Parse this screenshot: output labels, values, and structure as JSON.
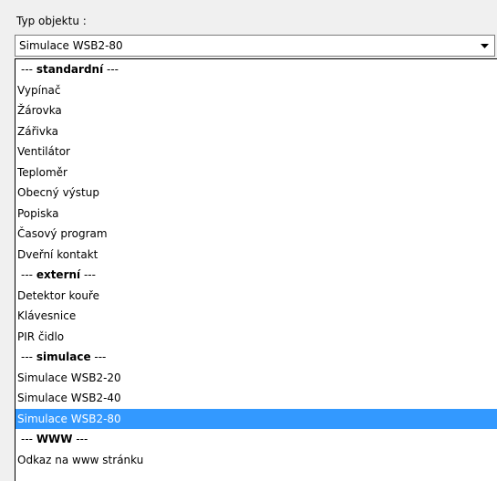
{
  "label": "Typ objektu :",
  "combo": {
    "value": "Simulace WSB2-80",
    "arrow_icon": "dropdown-arrow-icon"
  },
  "colors": {
    "selection": "#3399ff",
    "selection_text": "#ffffff",
    "background": "#f0f0f0"
  },
  "groups": {
    "standardni": {
      "dashes": "--- ",
      "name": "standardní",
      "tail": " ---"
    },
    "externi": {
      "dashes": "--- ",
      "name": "externí",
      "tail": " ---"
    },
    "simulace": {
      "dashes": "--- ",
      "name": "simulace",
      "tail": " ---"
    },
    "www": {
      "dashes": "--- ",
      "name": "WWW",
      "tail": " ---"
    }
  },
  "items": {
    "vypinac": "Vypínač",
    "zarovka": "Žárovka",
    "zarivka": "Zářivka",
    "ventilator": "Ventilátor",
    "teplomer": "Teploměr",
    "obecny_vystup": "Obecný výstup",
    "popiska": "Popiska",
    "casovy_program": "Časový program",
    "dverni_kontakt": "Dveřní kontakt",
    "detektor_koure": "Detektor kouře",
    "klavesnice": "Klávesnice",
    "pir_cidlo": "PIR čidlo",
    "wsb2_20": "Simulace WSB2-20",
    "wsb2_40": "Simulace WSB2-40",
    "wsb2_80": "Simulace WSB2-80",
    "odkaz": "Odkaz na www stránku"
  },
  "selected": "Simulace WSB2-80"
}
